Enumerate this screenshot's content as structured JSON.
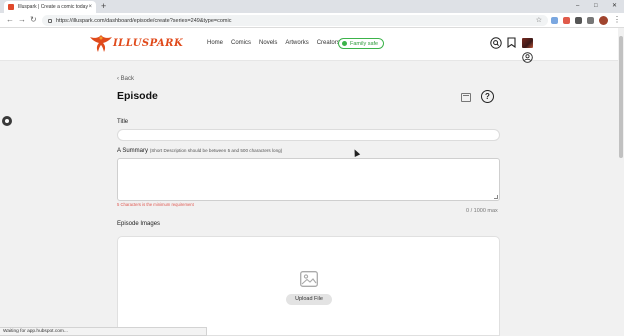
{
  "browser": {
    "tab_title": "Illuspark | Create a comic today",
    "tab_close": "×",
    "new_tab": "+",
    "url": "https://illuspark.com/dashboard/episode/create?series=249&type=comic",
    "window_controls": [
      "–",
      "□",
      "✕"
    ],
    "status_text": "Waiting for app.hubspot.com..."
  },
  "site": {
    "logo_text": "ILLUSPARK",
    "nav": [
      "Home",
      "Comics",
      "Novels",
      "Artworks",
      "Creators"
    ],
    "family_safe": "Family safe",
    "accent_color": "#e04a1b",
    "family_color": "#3cb34a"
  },
  "page": {
    "back_label": "Back",
    "title": "Episode",
    "help_label": "?",
    "title_label": "Title",
    "title_value": "",
    "summary_label": "A Summary",
    "summary_hint": "(Short Description should be between 5 and 500 characters long)",
    "summary_value": "",
    "summary_error": "5 Characters is the minimum requirement",
    "counter": "0 / 1000 max",
    "images_label": "Episode Images",
    "upload_label": "Upload File"
  },
  "icons": [
    "back-chevron-icon",
    "calendar-icon",
    "help-icon",
    "search-icon",
    "bookmark-icon",
    "user-icon",
    "image-icon"
  ]
}
